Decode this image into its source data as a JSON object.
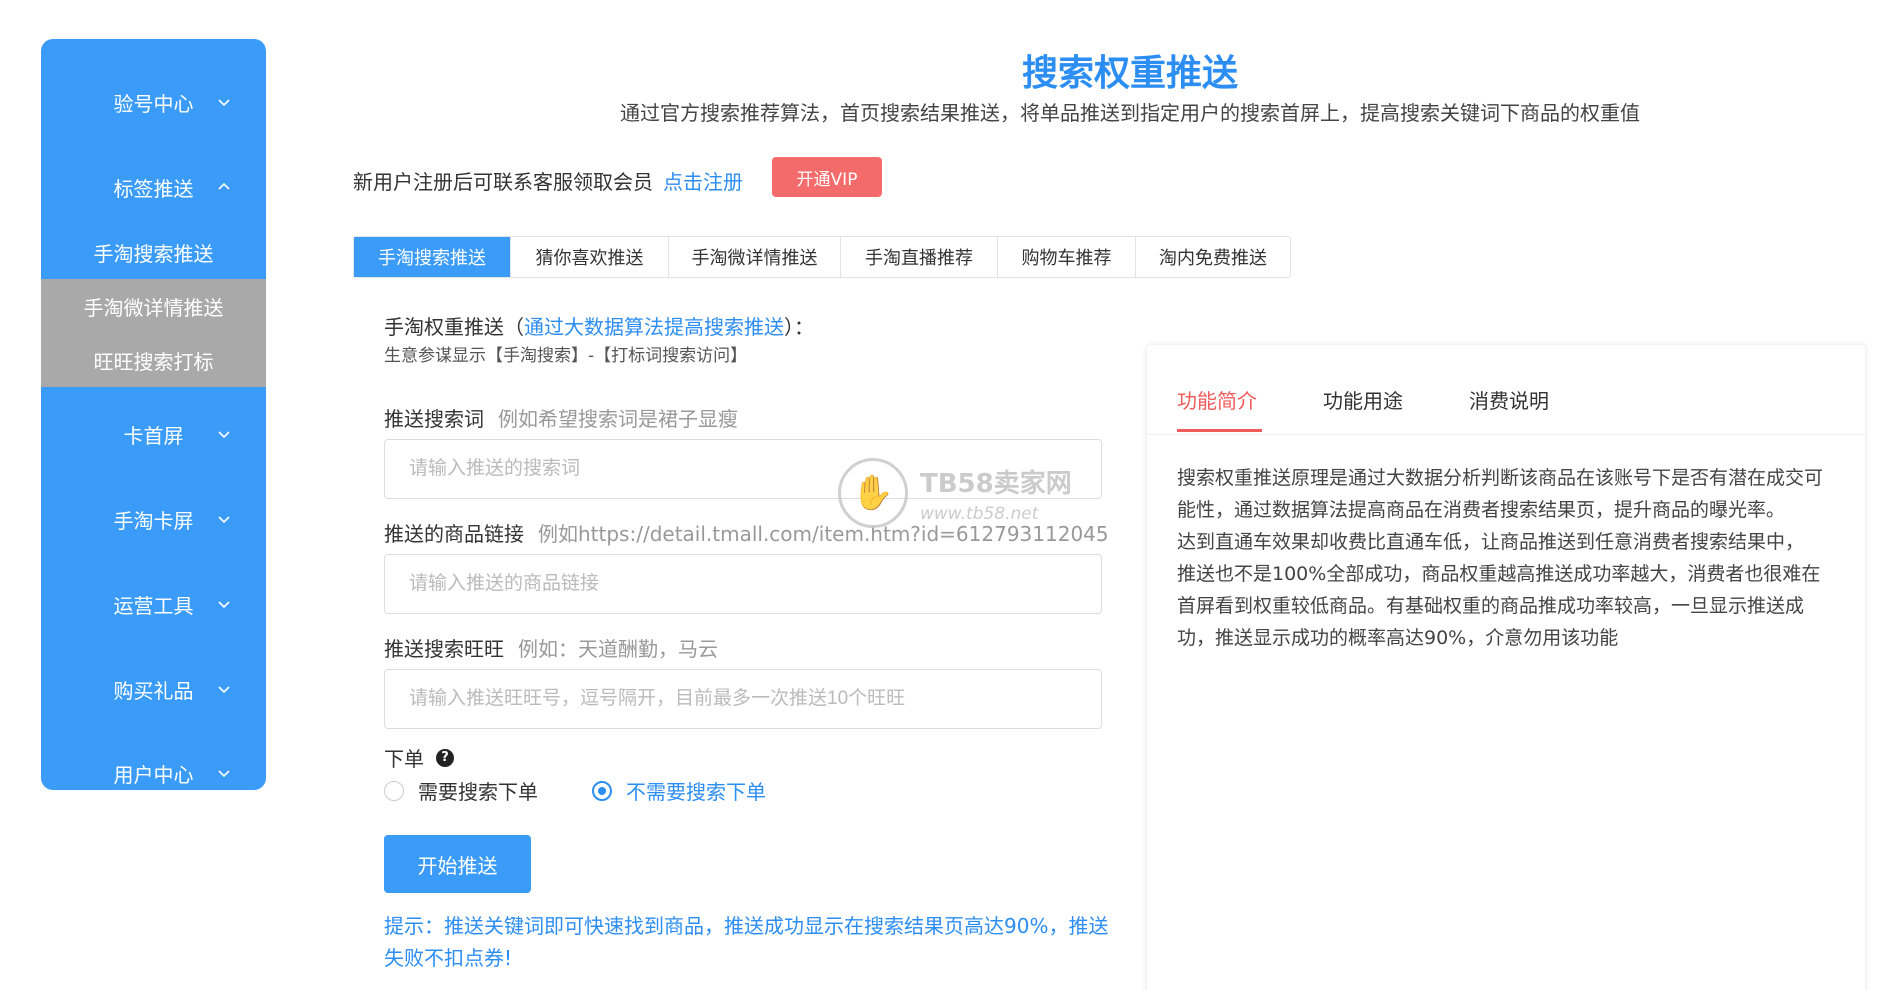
{
  "sidebar": {
    "menu": [
      {
        "label": "验号中心",
        "chevron": "chevron-down-icon"
      },
      {
        "label": "标签推送",
        "chevron": "chevron-up-icon"
      },
      {
        "label": "卡首屏",
        "chevron": "chevron-down-icon"
      },
      {
        "label": "手淘卡屏",
        "chevron": "chevron-down-icon"
      },
      {
        "label": "运营工具",
        "chevron": "chevron-down-icon"
      },
      {
        "label": "购买礼品",
        "chevron": "chevron-down-icon"
      },
      {
        "label": "用户中心",
        "chevron": "chevron-down-icon"
      }
    ],
    "submenu": [
      "手淘搜索推送",
      "手淘微详情推送",
      "旺旺搜索打标"
    ],
    "colors": {
      "bg": "#3a9cf8",
      "active_sub": "#a9a9a9"
    }
  },
  "header": {
    "title": "搜索权重推送",
    "subtitle": "通过官方搜索推荐算法，首页搜索结果推送，将单品推送到指定用户的搜索首屏上，提高搜索关键词下商品的权重值"
  },
  "promo": {
    "text": "新用户注册后可联系客服领取会员",
    "link": "点击注册",
    "vip_button": "开通VIP"
  },
  "tabs": [
    "手淘搜索推送",
    "猜你喜欢推送",
    "手淘微详情推送",
    "手淘直播推荐",
    "购物车推荐",
    "淘内免费推送"
  ],
  "form": {
    "section_title_prefix": "手淘权重推送（",
    "section_title_link": "通过大数据算法提高搜索推送",
    "section_title_suffix": "）：",
    "section_note": "生意参谋显示【手淘搜索】-【打标词搜索访问】",
    "keyword": {
      "label": "推送搜索词",
      "example": "例如希望搜索词是裙子显瘦",
      "placeholder": "请输入推送的搜索词",
      "value": ""
    },
    "link": {
      "label": "推送的商品链接",
      "example": "例如https://detail.tmall.com/item.htm?id=612793112045",
      "placeholder": "请输入推送的商品链接",
      "value": ""
    },
    "wangwang": {
      "label": "推送搜索旺旺",
      "example": "例如：天道酬勤，马云",
      "placeholder": "请输入推送旺旺号，逗号隔开，目前最多一次推送10个旺旺",
      "value": ""
    },
    "order": {
      "label": "下单",
      "options": [
        "需要搜索下单",
        "不需要搜索下单"
      ],
      "selected": "不需要搜索下单"
    },
    "submit": "开始推送",
    "tip": "提示：推送关键词即可快速找到商品，推送成功显示在搜索结果页高达90%，推送失败不扣点券!"
  },
  "watermark": {
    "brand": "TB58卖家网",
    "site": "www.tb58.net"
  },
  "panel": {
    "tabs": [
      "功能简介",
      "功能用途",
      "消费说明"
    ],
    "active_tab": "功能简介",
    "paragraphs": [
      "搜索权重推送原理是通过大数据分析判断该商品在该账号下是否有潜在成交可能性，通过数据算法提高商品在消费者搜索结果页，提升商品的曝光率。",
      "达到直通车效果却收费比直通车低，让商品推送到任意消费者搜索结果中，",
      "推送也不是100%全部成功，商品权重越高推送成功率越大，消费者也很难在首屏看到权重较低商品。有基础权重的商品推成功率较高，一旦显示推送成功，推送显示成功的概率高达90%，介意勿用该功能"
    ]
  }
}
